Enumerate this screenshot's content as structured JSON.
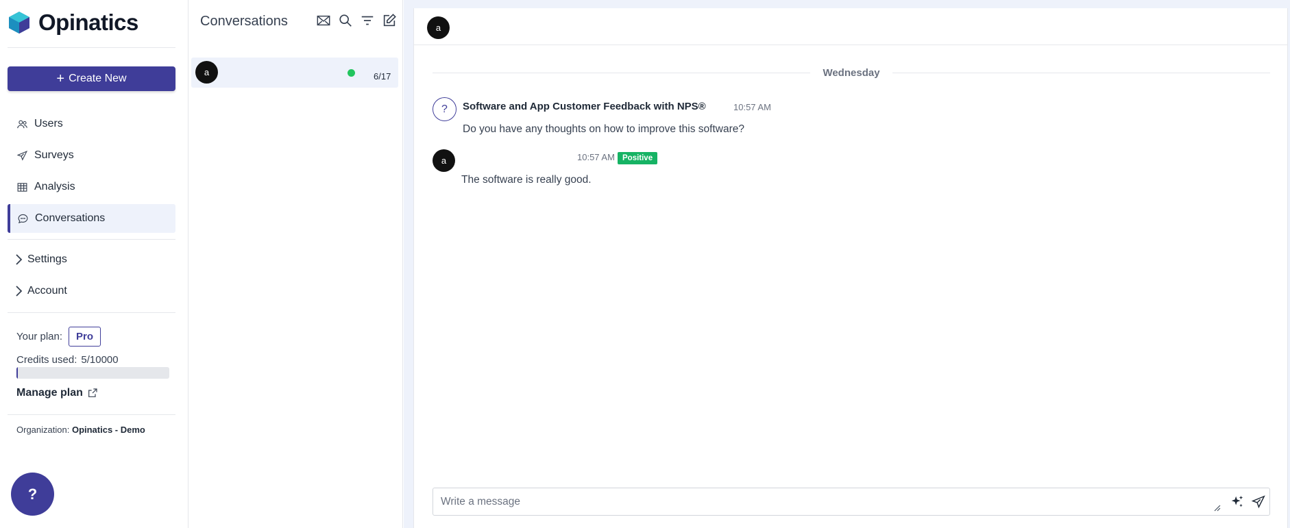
{
  "brand": {
    "name": "Opinatics"
  },
  "sidebar": {
    "create_label": "Create New",
    "items": [
      {
        "label": "Users",
        "icon": "users-icon"
      },
      {
        "label": "Surveys",
        "icon": "send-icon"
      },
      {
        "label": "Analysis",
        "icon": "table-icon"
      },
      {
        "label": "Conversations",
        "icon": "chat-icon",
        "active": true
      }
    ],
    "groups": [
      {
        "label": "Settings"
      },
      {
        "label": "Account"
      }
    ],
    "plan_label": "Your plan:",
    "plan_value": "Pro",
    "credits_label": "Credits used:",
    "credits_value": "5/10000",
    "credits_fraction": 0.0005,
    "manage_label": "Manage plan",
    "org_label": "Organization:",
    "org_value": "Opinatics - Demo",
    "help_label": "?"
  },
  "conversations": {
    "title": "Conversations",
    "tools": [
      "mail-icon",
      "search-icon",
      "filter-icon",
      "compose-icon"
    ],
    "items": [
      {
        "avatar": "a",
        "status": "online",
        "status_color": "#22c55e",
        "date": "6/17"
      }
    ]
  },
  "chat": {
    "header_avatar": "a",
    "day_label": "Wednesday",
    "question": {
      "icon": "?",
      "title": "Software and App Customer Feedback with NPS®",
      "time": "10:57 AM",
      "text": "Do you have any thoughts on how to improve this software?"
    },
    "answer": {
      "avatar": "a",
      "time": "10:57 AM",
      "sentiment": "Positive",
      "sentiment_color": "#16b364",
      "text": "The software is really good."
    },
    "composer_placeholder": "Write a message"
  },
  "colors": {
    "accent": "#3f3d99",
    "active_bg": "#eef2fb"
  }
}
